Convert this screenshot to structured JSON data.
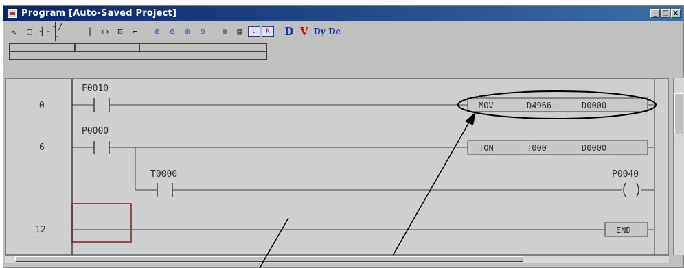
{
  "window": {
    "title": "Program [Auto-Saved Project]",
    "buttons": [
      "_",
      "□",
      "x"
    ]
  },
  "toolbar": {
    "tools": [
      {
        "icon": "pointer-icon",
        "glyph": "↖"
      },
      {
        "icon": "rect-select-icon",
        "glyph": "□"
      },
      {
        "icon": "no-contact-icon",
        "glyph": "┤├"
      },
      {
        "icon": "nc-contact-icon",
        "glyph": "┤/├"
      },
      {
        "icon": "horizontal-line-icon",
        "glyph": "—"
      },
      {
        "icon": "vertical-line-icon",
        "glyph": "|"
      },
      {
        "icon": "coil-icon",
        "glyph": "‹›"
      },
      {
        "icon": "function-block-icon",
        "glyph": "⊡"
      },
      {
        "icon": "branch-icon",
        "glyph": "⌐"
      },
      {
        "icon": "zoom-in-icon",
        "glyph": "⊕"
      },
      {
        "icon": "zoom-out-icon",
        "glyph": "⊖"
      },
      {
        "icon": "zoom-in-alt-icon",
        "glyph": "⊕"
      },
      {
        "icon": "zoom-out-alt-icon",
        "glyph": "⊖"
      },
      {
        "icon": "find-icon",
        "glyph": "⊛"
      },
      {
        "icon": "list-icon",
        "glyph": "▤"
      },
      {
        "icon": "monitor-u-icon",
        "glyph": "U"
      },
      {
        "icon": "monitor-r-icon",
        "glyph": "R"
      }
    ],
    "letter_tools": [
      {
        "icon": "device-d-icon",
        "glyph": "D",
        "color": "blue"
      },
      {
        "icon": "variable-v-icon",
        "glyph": "V",
        "color": "red"
      },
      {
        "icon": "device-dy-icon",
        "glyph": "Dy",
        "color": "blue"
      },
      {
        "icon": "device-dc-icon",
        "glyph": "Dc",
        "color": "blue"
      }
    ]
  },
  "ladder": {
    "steps": [
      "0",
      "6",
      "12"
    ],
    "contacts": [
      "F0010",
      "P0000",
      "T0000"
    ],
    "coil": "P0040",
    "instructions": [
      {
        "op": "MOV",
        "arg1": "D4966",
        "arg2": "D0000"
      },
      {
        "op": "TON",
        "arg1": "T000",
        "arg2": "D0000"
      },
      {
        "op": "END"
      }
    ]
  }
}
